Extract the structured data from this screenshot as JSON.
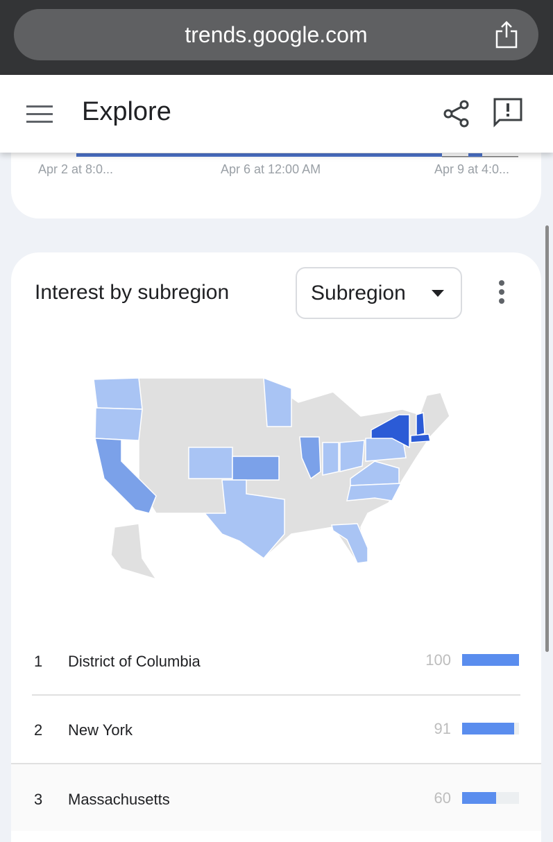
{
  "browser": {
    "url": "trends.google.com",
    "share_icon": "share-ios-icon"
  },
  "header": {
    "title": "Explore",
    "menu_icon": "hamburger-icon",
    "share_icon": "share-icon",
    "feedback_icon": "feedback-icon"
  },
  "timeline": {
    "x_labels": [
      "Apr 2 at 8:0...",
      "Apr 6 at 12:00 AM",
      "Apr 9 at 4:0..."
    ]
  },
  "subregion": {
    "title": "Interest by subregion",
    "dropdown": "Subregion",
    "colors": {
      "high": "#2b5bd6",
      "mid": "#7ba1e9",
      "low": "#a9c4f4",
      "none": "#e0e0e0"
    },
    "rows": [
      {
        "rank": "1",
        "name": "District of Columbia",
        "value": "100",
        "pct": 100
      },
      {
        "rank": "2",
        "name": "New York",
        "value": "91",
        "pct": 91
      },
      {
        "rank": "3",
        "name": "Massachusetts",
        "value": "60",
        "pct": 60
      }
    ]
  }
}
